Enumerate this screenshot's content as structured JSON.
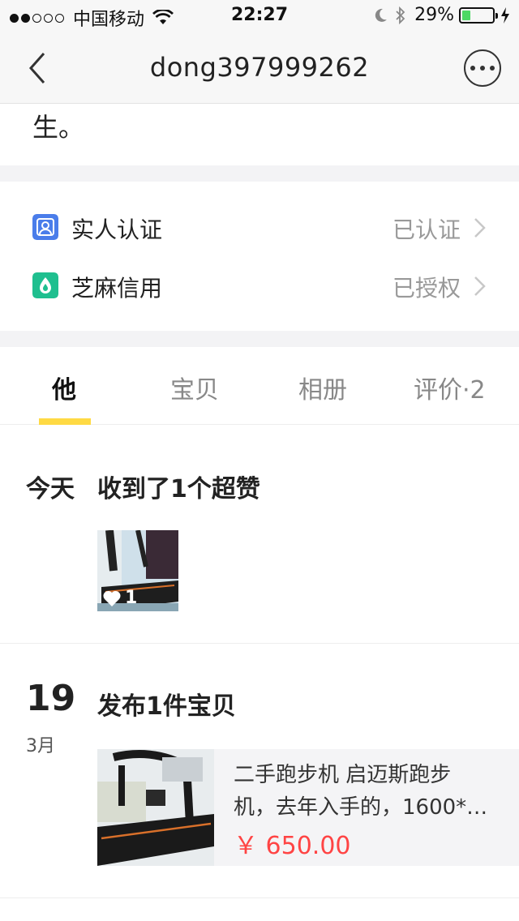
{
  "status_bar": {
    "carrier": "中国移动",
    "time": "22:27",
    "battery_percent": "29%",
    "battery_level": 0.29,
    "signal_bars_filled": 2,
    "signal_bars_total": 5
  },
  "nav": {
    "title": "dong397999262"
  },
  "bio": {
    "text": "生。"
  },
  "verifications": [
    {
      "label": "实人认证",
      "status": "已认证",
      "icon": "id-verify-icon"
    },
    {
      "label": "芝麻信用",
      "status": "已授权",
      "icon": "sesame-credit-icon"
    }
  ],
  "tabs": [
    {
      "label": "他",
      "active": true
    },
    {
      "label": "宝贝",
      "active": false
    },
    {
      "label": "相册",
      "active": false
    },
    {
      "label": "评价·2",
      "active": false
    }
  ],
  "feed": {
    "today": {
      "day_label": "今天",
      "title": "收到了1个超赞",
      "like_count": "1"
    },
    "post": {
      "day": "19",
      "month": "3月",
      "title": "发布1件宝贝",
      "desc_line1": "二手跑步机 启迈斯跑步",
      "desc_line2": "机，去年入手的，1600*…",
      "price": "￥ 650.00"
    }
  },
  "colors": {
    "accent_yellow": "#ffda44",
    "price_red": "#ff4444",
    "verify_blue": "#4a7dea",
    "sesame_green": "#1fbf8f"
  }
}
